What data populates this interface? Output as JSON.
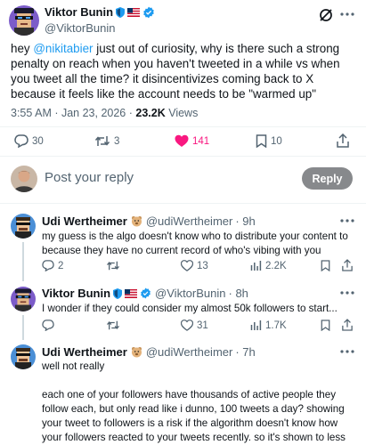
{
  "main_post": {
    "author_name": "Viktor Bunin",
    "handle": "@ViktorBunin",
    "text_before": "hey ",
    "mention": "@nikitabier",
    "text_after": " just out of curiosity, why is there such a strong penalty on reach when you haven't tweeted in a while vs when you tweet all the time? it disincentivizes coming back to X because it feels like the account needs to be \"warmed up\"",
    "timestamp": "3:55 AM · Jan 23, 2026 · ",
    "views_count": "23.2K",
    "views_label": " Views",
    "replies": "30",
    "reposts": "3",
    "likes": "141",
    "bookmarks": "10"
  },
  "reply_box": {
    "placeholder": "Post your reply",
    "button_label": "Reply"
  },
  "replies": [
    {
      "author_name": "Udi Wertheimer",
      "handle": "@udiWertheimer",
      "time": "· 9h",
      "text": "my guess is the algo doesn't know who to distribute your content to because they have no current record of who's vibing with you",
      "replies": "2",
      "reposts": "",
      "likes": "13",
      "views": "2.2K"
    },
    {
      "author_name": "Viktor Bunin",
      "handle": "@ViktorBunin",
      "time": "· 8h",
      "text": "I wonder if they could consider my almost 50k followers to start...",
      "replies": "",
      "reposts": "",
      "likes": "31",
      "views": "1.7K"
    },
    {
      "author_name": "Udi Wertheimer",
      "handle": "@udiWertheimer",
      "time": "· 7h",
      "text_line1": "well not really",
      "text_para": "each one of your followers have thousands of active people they follow each, but only read like i dunno, 100 tweets a day? showing your tweet to followers is a risk if the algorithm doesn't know how your followers reacted to your tweets recently. so it's shown to less people until you can prove yourself with some bangers"
    }
  ],
  "colors": {
    "accent": "#1d9bf0",
    "like_pink": "#f91880",
    "reply_button": "#87898c",
    "secondary_text": "#536471"
  }
}
